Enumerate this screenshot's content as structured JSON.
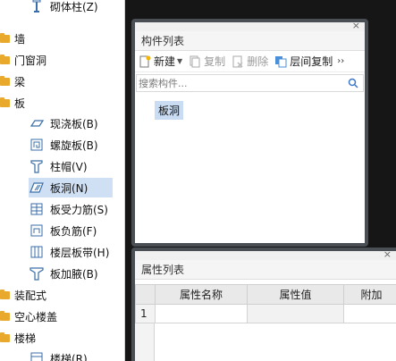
{
  "tree": {
    "partial_item": {
      "label": "砌体柱(Z)",
      "icon": "masonry-column-icon"
    },
    "items": [
      {
        "label": "墙",
        "level": 0
      },
      {
        "label": "门窗洞",
        "level": 0
      },
      {
        "label": "梁",
        "level": 0
      },
      {
        "label": "板",
        "level": 0
      },
      {
        "label": "现浇板(B)",
        "level": 1,
        "icon": "cast-slab-icon"
      },
      {
        "label": "螺旋板(B)",
        "level": 1,
        "icon": "spiral-slab-icon"
      },
      {
        "label": "柱帽(V)",
        "level": 1,
        "icon": "column-cap-icon"
      },
      {
        "label": "板洞(N)",
        "level": 1,
        "icon": "slab-hole-icon",
        "selected": true
      },
      {
        "label": "板受力筋(S)",
        "level": 1,
        "icon": "slab-rebar-icon"
      },
      {
        "label": "板负筋(F)",
        "level": 1,
        "icon": "negative-rebar-icon"
      },
      {
        "label": "楼层板带(H)",
        "level": 1,
        "icon": "floor-strip-icon"
      },
      {
        "label": "板加腋(B)",
        "level": 1,
        "icon": "slab-haunch-icon"
      },
      {
        "label": "装配式",
        "level": 0
      },
      {
        "label": "空心楼盖",
        "level": 0
      },
      {
        "label": "楼梯",
        "level": 0
      }
    ],
    "partial_bottom": {
      "label": "楼梯(R)",
      "icon": "stair-icon"
    }
  },
  "component_panel": {
    "title": "构件列表",
    "close": "×",
    "toolbar": {
      "new_label": "新建",
      "copy_label": "复制",
      "delete_label": "删除",
      "floor_copy_label": "层间复制",
      "more": "››"
    },
    "search_placeholder": "搜索构件...",
    "items": [
      "板洞"
    ]
  },
  "attribute_panel": {
    "title": "属性列表",
    "close": "×",
    "columns": [
      "属性名称",
      "属性值",
      "附加"
    ],
    "rows": [
      {
        "num": "1",
        "name": "",
        "value": "",
        "extra": ""
      }
    ]
  },
  "colors": {
    "selection": "#cfe0f5",
    "panel_border": "#4a4f56",
    "folder": "#e8a92d",
    "background": "#161616"
  }
}
